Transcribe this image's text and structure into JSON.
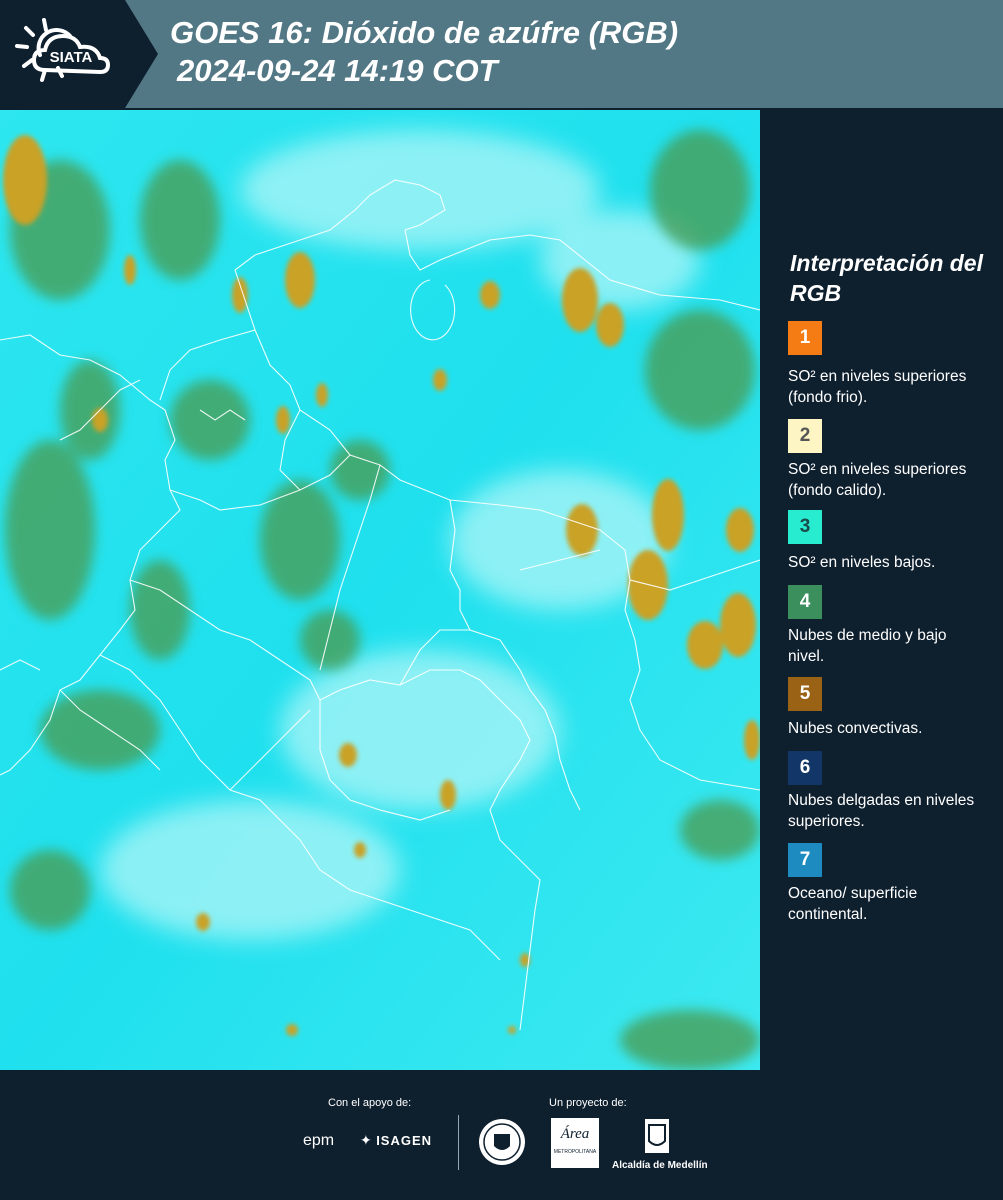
{
  "header": {
    "logo_text": "SIATA",
    "title_line1": "GOES 16: Dióxido de azúfre (RGB)",
    "title_line2": "2024-09-24 14:19 COT"
  },
  "legend": {
    "title": "Interpretación del RGB",
    "items": [
      {
        "number": "1",
        "label": "SO² en niveles superiores (fondo frio).",
        "color": "#f57c14",
        "text_color": "#ffffff"
      },
      {
        "number": "2",
        "label": "SO² en niveles superiores (fondo calido).",
        "color": "#fdf5c4",
        "text_color": "#555555"
      },
      {
        "number": "3",
        "label": "SO² en niveles bajos.",
        "color": "#27ecd0",
        "text_color": "#1a4d4a"
      },
      {
        "number": "4",
        "label": "Nubes de medio y bajo nivel.",
        "color": "#3b8f5c",
        "text_color": "#ffffff"
      },
      {
        "number": "5",
        "label": "Nubes convectivas.",
        "color": "#9a6214",
        "text_color": "#ffffff"
      },
      {
        "number": "6",
        "label": "Nubes delgadas en niveles superiores.",
        "color": "#123667",
        "text_color": "#ffffff"
      },
      {
        "number": "7",
        "label": "Oceano/ superficie continental.",
        "color": "#1d8ac0",
        "text_color": "#ffffff"
      }
    ]
  },
  "footer": {
    "support_label": "Con el apoyo de:",
    "project_label": "Un proyecto de:",
    "epm": "epm",
    "isagen": "ISAGEN",
    "area_text": "Área",
    "area_sub": "METROPOLITANA",
    "alcaldia": "Alcaldía de Medellín"
  },
  "colors": {
    "header_bg": "#537885",
    "logo_bg": "#0e1f2e",
    "page_bg": "#0e1f2e",
    "map_cyan": "#22e3ee",
    "cloud_yellow": "#c9a227",
    "cloud_green": "#4c9a4e"
  }
}
